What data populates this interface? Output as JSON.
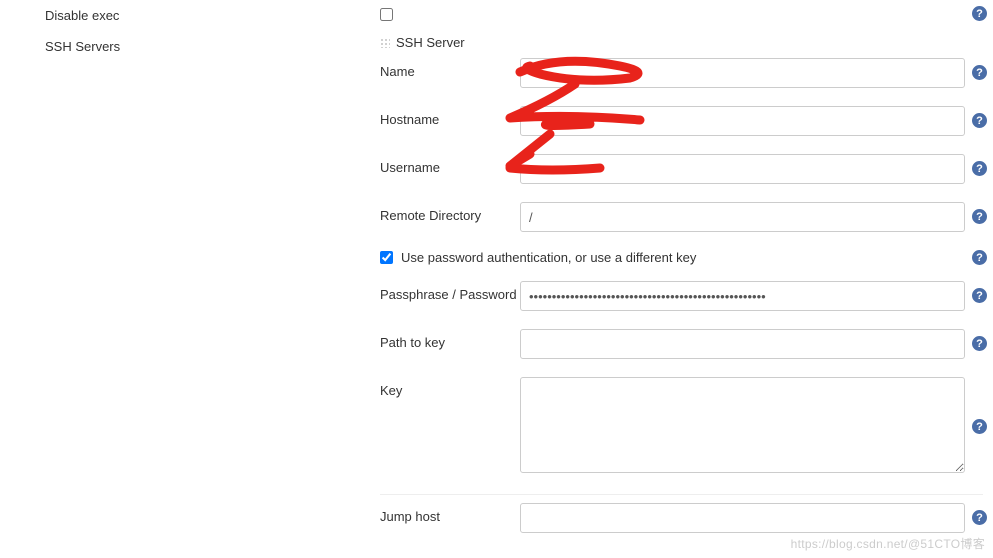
{
  "left": {
    "disable_exec": "Disable exec",
    "ssh_servers": "SSH Servers"
  },
  "ssh": {
    "header": "SSH Server",
    "name_label": "Name",
    "name_value": "",
    "hostname_label": "Hostname",
    "hostname_value": "",
    "username_label": "Username",
    "username_value": "",
    "remote_dir_label": "Remote Directory",
    "remote_dir_value": "/",
    "use_pw_auth_label": "Use password authentication, or use a different key",
    "passphrase_label": "Passphrase / Password",
    "passphrase_value": "••••••••••••••••••••••••••••••••••••••••••••••••••••",
    "path_key_label": "Path to key",
    "path_key_value": "",
    "key_label": "Key",
    "key_value": "",
    "jump_host_label": "Jump host",
    "jump_host_value": ""
  },
  "watermark": "https://blog.csdn.net/@51CTO博客"
}
